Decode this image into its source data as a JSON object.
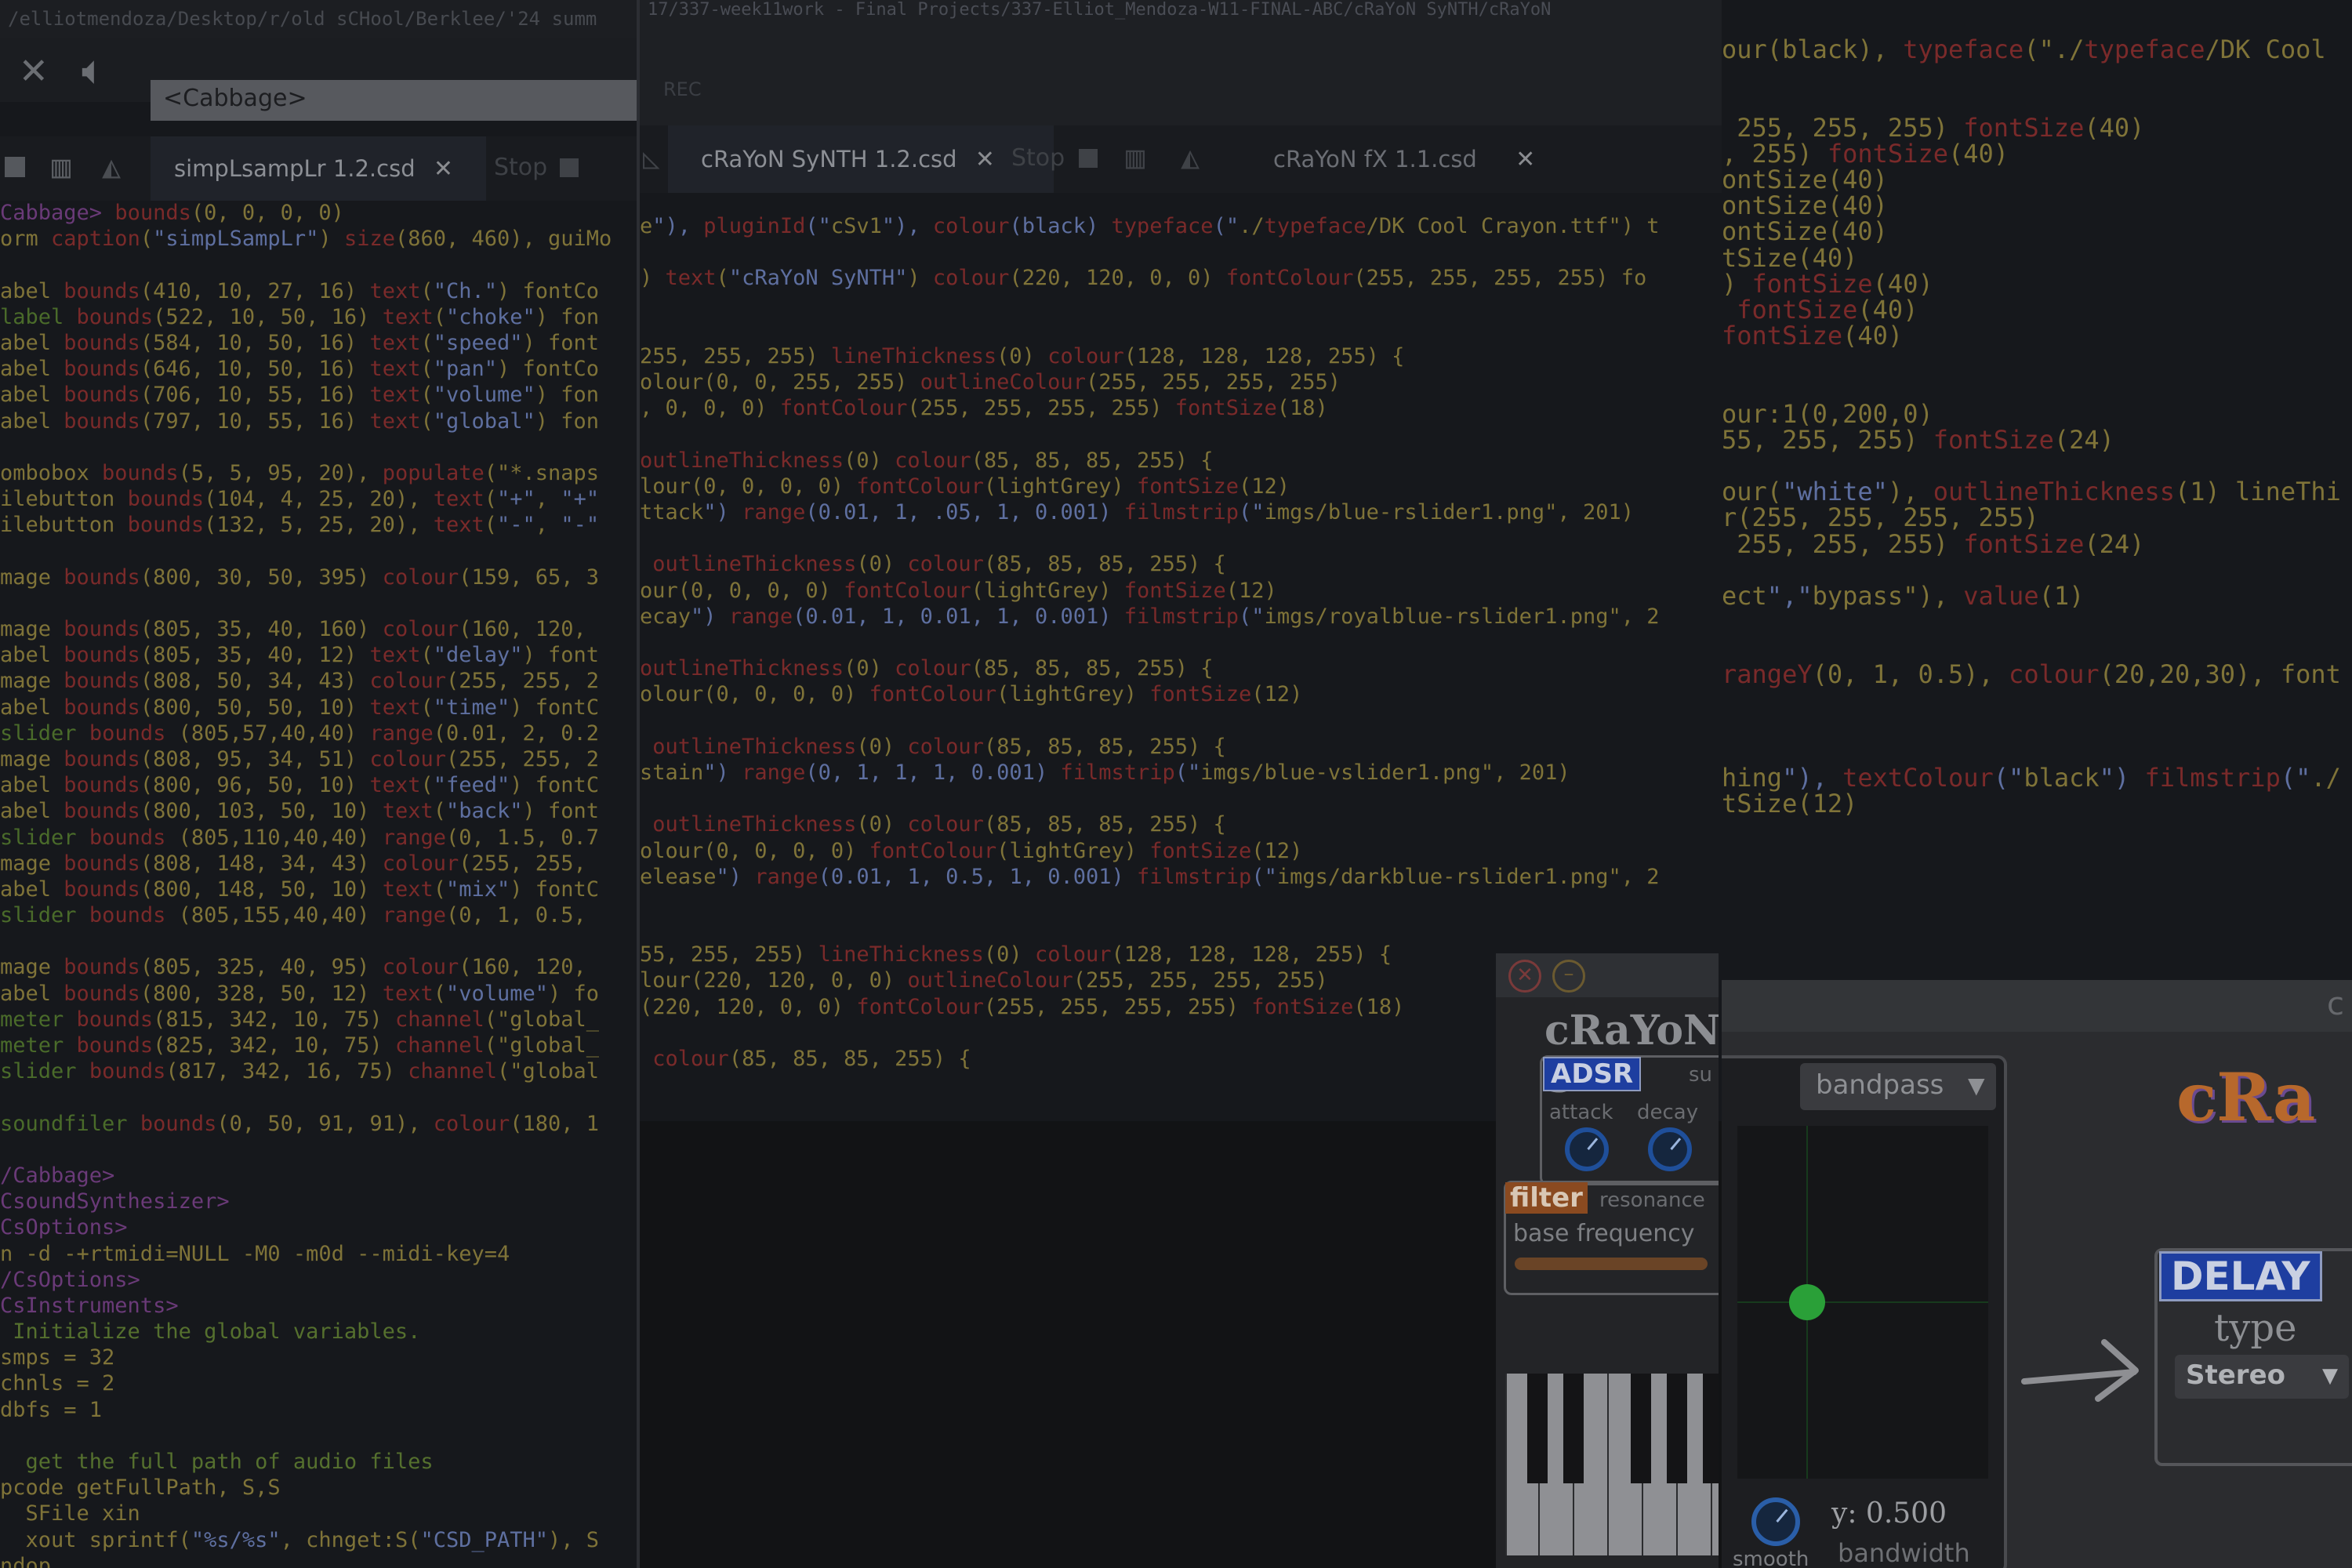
{
  "left_window": {
    "path": "/elliotmendoza/Desktop/r/old sCHool/Berklee/'24 summ",
    "cabbage_field": "<Cabbage>",
    "tab_label": "simpLsampLr 1.2.csd",
    "stop_label": "Stop",
    "code_lines": [
      "Cabbage> bounds(0, 0, 0, 0)",
      "orm caption(\"simpLSampLr\") size(860, 460), guiMo",
      "",
      "abel bounds(410, 10, 27, 16) text(\"Ch.\") fontCo",
      "label bounds(522, 10, 50, 16) text(\"choke\") fon",
      "abel bounds(584, 10, 50, 16) text(\"speed\") font",
      "abel bounds(646, 10, 50, 16) text(\"pan\") fontCo",
      "abel bounds(706, 10, 55, 16) text(\"volume\") fon",
      "abel bounds(797, 10, 55, 16) text(\"global\") fon",
      "",
      "ombobox bounds(5, 5, 95, 20), populate(\"*.snaps",
      "ilebutton bounds(104, 4, 25, 20), text(\"+\", \"+\"",
      "ilebutton bounds(132, 5, 25, 20), text(\"-\", \"-\"",
      "",
      "mage bounds(800, 30, 50, 395) colour(159, 65, 3",
      "",
      "mage bounds(805, 35, 40, 160) colour(160, 120, ",
      "abel bounds(805, 35, 40, 12) text(\"delay\") font",
      "mage bounds(808, 50, 34, 43) colour(255, 255, 2",
      "abel bounds(800, 50, 50, 10) text(\"time\") fontC",
      "slider bounds (805,57,40,40) range(0.01, 2, 0.2",
      "mage bounds(808, 95, 34, 51) colour(255, 255, 2",
      "abel bounds(800, 96, 50, 10) text(\"feed\") fontC",
      "abel bounds(800, 103, 50, 10) text(\"back\") font",
      "slider bounds (805,110,40,40) range(0, 1.5, 0.7",
      "mage bounds(808, 148, 34, 43) colour(255, 255, ",
      "abel bounds(800, 148, 50, 10) text(\"mix\") fontC",
      "slider bounds (805,155,40,40) range(0, 1, 0.5, ",
      "",
      "mage bounds(805, 325, 40, 95) colour(160, 120, ",
      "abel bounds(800, 328, 50, 12) text(\"volume\") fo",
      "meter bounds(815, 342, 10, 75) channel(\"global_",
      "meter bounds(825, 342, 10, 75) channel(\"global_",
      "slider bounds(817, 342, 16, 75) channel(\"global",
      "",
      "soundfiler bounds(0, 50, 91, 91), colour(180, 1",
      "",
      "/Cabbage>",
      "CsoundSynthesizer>",
      "CsOptions>",
      "n -d -+rtmidi=NULL -M0 -m0d --midi-key=4",
      "/CsOptions>",
      "CsInstruments>",
      " Initialize the global variables.",
      "smps = 32",
      "chnls = 2",
      "dbfs = 1",
      "",
      "  get the full path of audio files",
      "pcode getFullPath, S,S",
      "  SFile xin",
      "  xout sprintf(\"%s/%s\", chnget:S(\"CSD_PATH\"), S",
      "ndop"
    ]
  },
  "middle_window": {
    "path": "17/337-week11work - Final Projects/337-Elliot_Mendoza-W11-FINAL-ABC/cRaYoN SyNTH/cRaYoN",
    "rec_label": "REC",
    "tab_synth": "cRaYoN SyNTH 1.2.csd",
    "stop_label": "Stop",
    "tab_fx": "cRaYoN fX 1.1.csd",
    "code_lines": [
      "e\"), pluginId(\"cSv1\"), colour(black) typeface(\"./typeface/DK Cool Crayon.ttf\") t",
      "",
      ") text(\"cRaYoN SyNTH\") colour(220, 120, 0, 0) fontColour(255, 255, 255, 255) fo",
      "",
      "",
      "255, 255, 255) lineThickness(0) colour(128, 128, 128, 255) {",
      "olour(0, 0, 255, 255) outlineColour(255, 255, 255, 255)",
      ", 0, 0, 0) fontColour(255, 255, 255, 255) fontSize(18)",
      "",
      "outlineThickness(0) colour(85, 85, 85, 255) {",
      "lour(0, 0, 0, 0) fontColour(lightGrey) fontSize(12)",
      "ttack\") range(0.01, 1, .05, 1, 0.001) filmstrip(\"imgs/blue-rslider1.png\", 201)",
      "",
      " outlineThickness(0) colour(85, 85, 85, 255) {",
      "our(0, 0, 0, 0) fontColour(lightGrey) fontSize(12)",
      "ecay\") range(0.01, 1, 0.01, 1, 0.001) filmstrip(\"imgs/royalblue-rslider1.png\", 2",
      "",
      "outlineThickness(0) colour(85, 85, 85, 255) {",
      "olour(0, 0, 0, 0) fontColour(lightGrey) fontSize(12)",
      "",
      " outlineThickness(0) colour(85, 85, 85, 255) {",
      "stain\") range(0, 1, 1, 1, 0.001) filmstrip(\"imgs/blue-vslider1.png\", 201)",
      "",
      " outlineThickness(0) colour(85, 85, 85, 255) {",
      "olour(0, 0, 0, 0) fontColour(lightGrey) fontSize(12)",
      "elease\") range(0.01, 1, 0.5, 1, 0.001) filmstrip(\"imgs/darkblue-rslider1.png\", 2",
      "",
      "",
      "55, 255, 255) lineThickness(0) colour(128, 128, 128, 255) {",
      "lour(220, 120, 0, 0) outlineColour(255, 255, 255, 255)",
      "(220, 120, 0, 0) fontColour(255, 255, 255, 255) fontSize(18)",
      "",
      " colour(85, 85, 85, 255) {"
    ]
  },
  "right_window": {
    "code_lines": [
      "our(black), typeface(\"./typeface/DK Cool",
      "",
      "",
      " 255, 255, 255) fontSize(40)",
      ", 255) fontSize(40)",
      "ontSize(40)",
      "ontSize(40)",
      "ontSize(40)",
      "tSize(40)",
      ") fontSize(40)",
      " fontSize(40)",
      "fontSize(40)",
      "",
      "",
      "our:1(0,200,0)",
      "55, 255, 255) fontSize(24)",
      "",
      "our(\"white\"), outlineThickness(1) lineThi",
      "r(255, 255, 255, 255)",
      " 255, 255, 255) fontSize(24)",
      "",
      "ect\",\"bypass\"), value(1)",
      "",
      "",
      "rangeY(0, 1, 0.5), colour(20,20,30), font",
      "",
      "",
      "",
      "hing\"), textColour(\"black\") filmstrip(\"./",
      "tSize(12)"
    ]
  },
  "synth_plugin": {
    "title": "cRaYoN S",
    "adsr_label": "ADSR",
    "attack_label": "attack",
    "decay_label": "decay",
    "sustain_abbr": "su",
    "filter_label": "filter",
    "resonance_label": "resonance",
    "base_freq_label": "base frequency"
  },
  "fx_plugin": {
    "filter_type": "bandpass",
    "xy_readout": "y: 0.500",
    "smooth_label": "smooth",
    "bandwidth_label": "bandwidth",
    "title_partial": "cRa",
    "delay_label": "DELAY",
    "type_label": "type",
    "type_value": "Stereo",
    "header_letter": "c"
  },
  "colors": {
    "background": "#0d0e10",
    "editor_bg": "#16181c",
    "orange": "#b7682c",
    "blue_badge": "#1e3ea0",
    "green_dot": "#2aa038"
  }
}
